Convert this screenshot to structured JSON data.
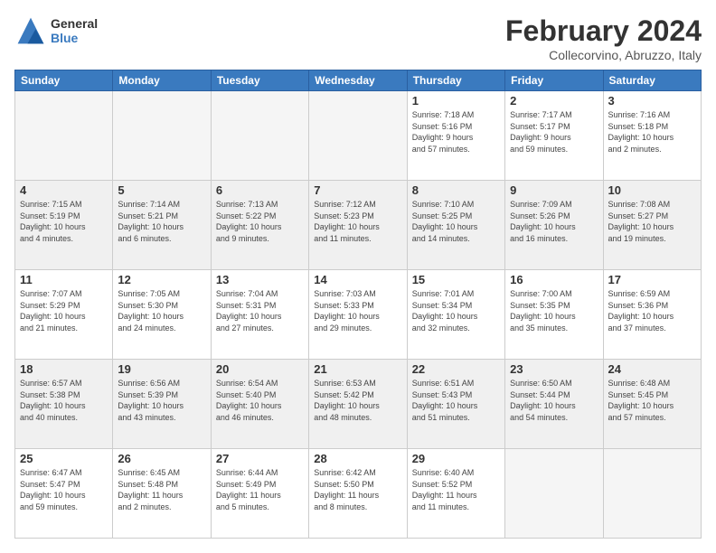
{
  "header": {
    "logo_line1": "General",
    "logo_line2": "Blue",
    "month_title": "February 2024",
    "subtitle": "Collecorvino, Abruzzo, Italy"
  },
  "weekdays": [
    "Sunday",
    "Monday",
    "Tuesday",
    "Wednesday",
    "Thursday",
    "Friday",
    "Saturday"
  ],
  "weeks": [
    [
      {
        "day": "",
        "info": "",
        "empty": true
      },
      {
        "day": "",
        "info": "",
        "empty": true
      },
      {
        "day": "",
        "info": "",
        "empty": true
      },
      {
        "day": "",
        "info": "",
        "empty": true
      },
      {
        "day": "1",
        "info": "Sunrise: 7:18 AM\nSunset: 5:16 PM\nDaylight: 9 hours\nand 57 minutes."
      },
      {
        "day": "2",
        "info": "Sunrise: 7:17 AM\nSunset: 5:17 PM\nDaylight: 9 hours\nand 59 minutes."
      },
      {
        "day": "3",
        "info": "Sunrise: 7:16 AM\nSunset: 5:18 PM\nDaylight: 10 hours\nand 2 minutes."
      }
    ],
    [
      {
        "day": "4",
        "info": "Sunrise: 7:15 AM\nSunset: 5:19 PM\nDaylight: 10 hours\nand 4 minutes."
      },
      {
        "day": "5",
        "info": "Sunrise: 7:14 AM\nSunset: 5:21 PM\nDaylight: 10 hours\nand 6 minutes."
      },
      {
        "day": "6",
        "info": "Sunrise: 7:13 AM\nSunset: 5:22 PM\nDaylight: 10 hours\nand 9 minutes."
      },
      {
        "day": "7",
        "info": "Sunrise: 7:12 AM\nSunset: 5:23 PM\nDaylight: 10 hours\nand 11 minutes."
      },
      {
        "day": "8",
        "info": "Sunrise: 7:10 AM\nSunset: 5:25 PM\nDaylight: 10 hours\nand 14 minutes."
      },
      {
        "day": "9",
        "info": "Sunrise: 7:09 AM\nSunset: 5:26 PM\nDaylight: 10 hours\nand 16 minutes."
      },
      {
        "day": "10",
        "info": "Sunrise: 7:08 AM\nSunset: 5:27 PM\nDaylight: 10 hours\nand 19 minutes."
      }
    ],
    [
      {
        "day": "11",
        "info": "Sunrise: 7:07 AM\nSunset: 5:29 PM\nDaylight: 10 hours\nand 21 minutes."
      },
      {
        "day": "12",
        "info": "Sunrise: 7:05 AM\nSunset: 5:30 PM\nDaylight: 10 hours\nand 24 minutes."
      },
      {
        "day": "13",
        "info": "Sunrise: 7:04 AM\nSunset: 5:31 PM\nDaylight: 10 hours\nand 27 minutes."
      },
      {
        "day": "14",
        "info": "Sunrise: 7:03 AM\nSunset: 5:33 PM\nDaylight: 10 hours\nand 29 minutes."
      },
      {
        "day": "15",
        "info": "Sunrise: 7:01 AM\nSunset: 5:34 PM\nDaylight: 10 hours\nand 32 minutes."
      },
      {
        "day": "16",
        "info": "Sunrise: 7:00 AM\nSunset: 5:35 PM\nDaylight: 10 hours\nand 35 minutes."
      },
      {
        "day": "17",
        "info": "Sunrise: 6:59 AM\nSunset: 5:36 PM\nDaylight: 10 hours\nand 37 minutes."
      }
    ],
    [
      {
        "day": "18",
        "info": "Sunrise: 6:57 AM\nSunset: 5:38 PM\nDaylight: 10 hours\nand 40 minutes."
      },
      {
        "day": "19",
        "info": "Sunrise: 6:56 AM\nSunset: 5:39 PM\nDaylight: 10 hours\nand 43 minutes."
      },
      {
        "day": "20",
        "info": "Sunrise: 6:54 AM\nSunset: 5:40 PM\nDaylight: 10 hours\nand 46 minutes."
      },
      {
        "day": "21",
        "info": "Sunrise: 6:53 AM\nSunset: 5:42 PM\nDaylight: 10 hours\nand 48 minutes."
      },
      {
        "day": "22",
        "info": "Sunrise: 6:51 AM\nSunset: 5:43 PM\nDaylight: 10 hours\nand 51 minutes."
      },
      {
        "day": "23",
        "info": "Sunrise: 6:50 AM\nSunset: 5:44 PM\nDaylight: 10 hours\nand 54 minutes."
      },
      {
        "day": "24",
        "info": "Sunrise: 6:48 AM\nSunset: 5:45 PM\nDaylight: 10 hours\nand 57 minutes."
      }
    ],
    [
      {
        "day": "25",
        "info": "Sunrise: 6:47 AM\nSunset: 5:47 PM\nDaylight: 10 hours\nand 59 minutes."
      },
      {
        "day": "26",
        "info": "Sunrise: 6:45 AM\nSunset: 5:48 PM\nDaylight: 11 hours\nand 2 minutes."
      },
      {
        "day": "27",
        "info": "Sunrise: 6:44 AM\nSunset: 5:49 PM\nDaylight: 11 hours\nand 5 minutes."
      },
      {
        "day": "28",
        "info": "Sunrise: 6:42 AM\nSunset: 5:50 PM\nDaylight: 11 hours\nand 8 minutes."
      },
      {
        "day": "29",
        "info": "Sunrise: 6:40 AM\nSunset: 5:52 PM\nDaylight: 11 hours\nand 11 minutes."
      },
      {
        "day": "",
        "info": "",
        "empty": true
      },
      {
        "day": "",
        "info": "",
        "empty": true
      }
    ]
  ]
}
